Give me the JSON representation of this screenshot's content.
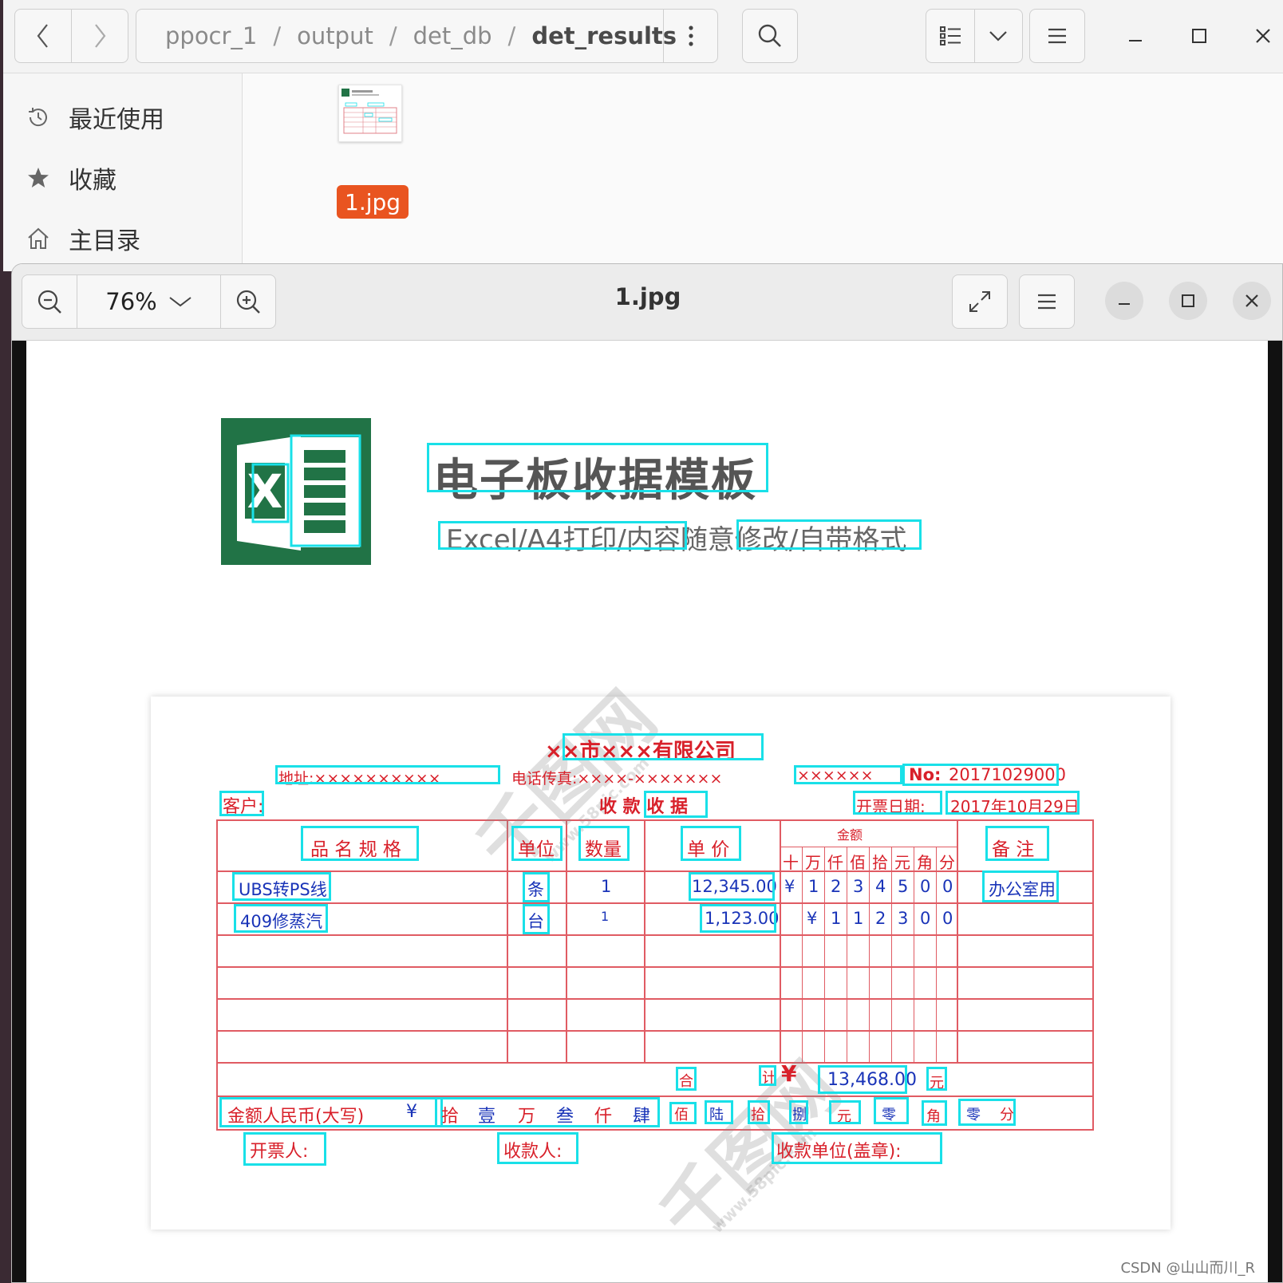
{
  "file_manager": {
    "path": [
      "ppocr_1",
      "output",
      "det_db",
      "det_results"
    ],
    "path_separator": "/",
    "sidebar": [
      {
        "label": "最近使用",
        "icon": "clock-icon"
      },
      {
        "label": "收藏",
        "icon": "star-icon"
      },
      {
        "label": "主目录",
        "icon": "home-icon"
      }
    ],
    "files": [
      {
        "name": "1.jpg",
        "selected": true
      }
    ]
  },
  "viewer": {
    "title": "1.jpg",
    "zoom": "76%"
  },
  "image": {
    "heading": "电子板收据模板",
    "subheading": "Excel/A4打印/内容随意修改/自带格式",
    "receipt": {
      "company": "××市×××有限公司",
      "address_label": "地址:××××××××××",
      "phone_label": "电话传真:××××-×××××××",
      "phone_extra": "××××××",
      "no_label": "No:",
      "no_value": "20171029000",
      "customer_label": "客户:",
      "receipt_title": "收 款 收 据",
      "date_label": "开票日期:",
      "date_value": "2017年10月29日",
      "headers": {
        "name": "品 名 规 格",
        "unit": "单位",
        "qty": "数量",
        "price": "单 价",
        "amount_group": "金额",
        "note": "备 注"
      },
      "amount_cols": [
        "十",
        "万",
        "仟",
        "佰",
        "拾",
        "元",
        "角",
        "分"
      ],
      "rows": [
        {
          "name": "UBS转PS线",
          "unit": "条",
          "qty": "1",
          "price": "12,345.00",
          "digits": [
            "¥",
            "1",
            "2",
            "3",
            "4",
            "5",
            "0",
            "0"
          ],
          "note": "办公室用"
        },
        {
          "name": "409修蒸汽",
          "unit": "台",
          "qty": "1",
          "price": "1,123.00",
          "digits": [
            "",
            "¥",
            "1",
            "1",
            "2",
            "3",
            "0",
            "0"
          ],
          "note": ""
        }
      ],
      "total_label": "合",
      "total_label2": "计",
      "total_symbol": "¥",
      "total_value": "13,468.00",
      "total_unit": "元",
      "capital_label": "金额人民币(大写)",
      "capital_parts": [
        "¥",
        "拾",
        "壹",
        "万",
        "叁",
        "仟",
        "肆",
        "佰",
        "陆",
        "拾",
        "捌",
        "元",
        "零",
        "角",
        "零",
        "分"
      ],
      "issuer_label": "开票人:",
      "payee_label": "收款人:",
      "payee_unit_label": "收款单位(盖章):"
    },
    "watermark": "千图网",
    "watermark_url": "www.58pic.com",
    "credit": "CSDN @山山而川_R"
  },
  "colors": {
    "accent": "#e95420",
    "ocr_box": "#19e0e8",
    "receipt_red": "#d8202a",
    "receipt_blue": "#1a34b8",
    "excel_green": "#217346"
  }
}
